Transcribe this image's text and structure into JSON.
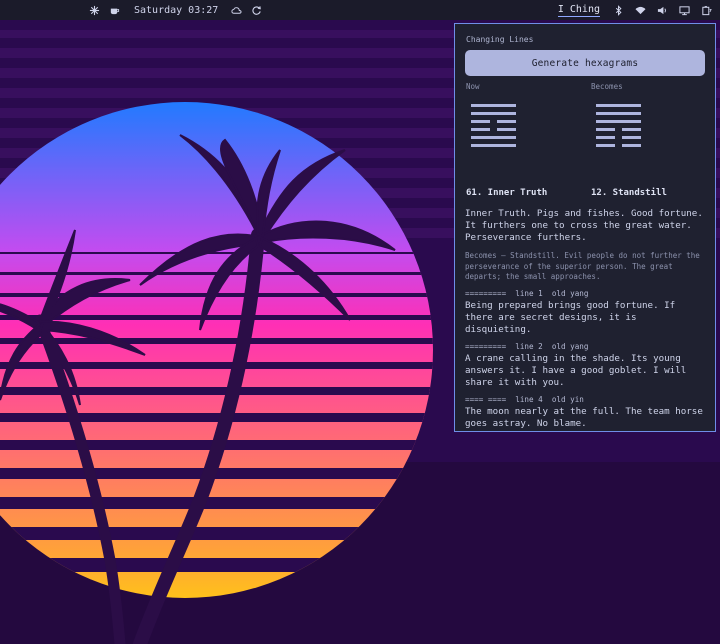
{
  "topbar": {
    "clock": "Saturday 03:27",
    "active_app": "I Ching",
    "left_icons": [
      "workspace-icon",
      "coffee-icon"
    ],
    "status_icons": [
      "cloud-icon",
      "refresh-icon"
    ],
    "tray_icons": [
      "bluetooth-icon",
      "wifi-icon",
      "volume-icon",
      "display-icon",
      "battery-icon"
    ]
  },
  "panel": {
    "title": "Changing Lines",
    "generate_label": "Generate hexagrams",
    "now_label": "Now",
    "becomes_label": "Becomes",
    "now_hexagram": {
      "number_name": "61. Inner Truth",
      "lines_bottom_to_top": [
        "yang",
        "yang",
        "yin",
        "yin",
        "yang",
        "yang"
      ]
    },
    "becomes_hexagram": {
      "number_name": "12. Standstill",
      "lines_bottom_to_top": [
        "yin",
        "yin",
        "yin",
        "yang",
        "yang",
        "yang"
      ]
    },
    "judgement": "Inner Truth. Pigs and fishes. Good fortune. It furthers one to cross the great water. Perseverance furthers.",
    "becomes_text": "Becomes — Standstill. Evil people do not further the perseverance of the superior person. The great departs; the small approaches.",
    "changing_lines": [
      {
        "header": "=========  line 1  old yang",
        "text": "Being prepared brings good fortune. If there are secret designs, it is disquieting."
      },
      {
        "header": "=========  line 2  old yang",
        "text": "A crane calling in the shade. Its young answers it. I have a good goblet. I will share it with you."
      },
      {
        "header": "==== ====  line 4  old yin",
        "text": "The moon nearly at the full. The team horse goes astray. No blame."
      }
    ]
  },
  "colors": {
    "accent": "#6f8ee8",
    "button": "#aeb5de",
    "panel_bg": "#1f2130",
    "wallpaper_bg": "#2a0a4e",
    "palm": "#2b0d47"
  }
}
